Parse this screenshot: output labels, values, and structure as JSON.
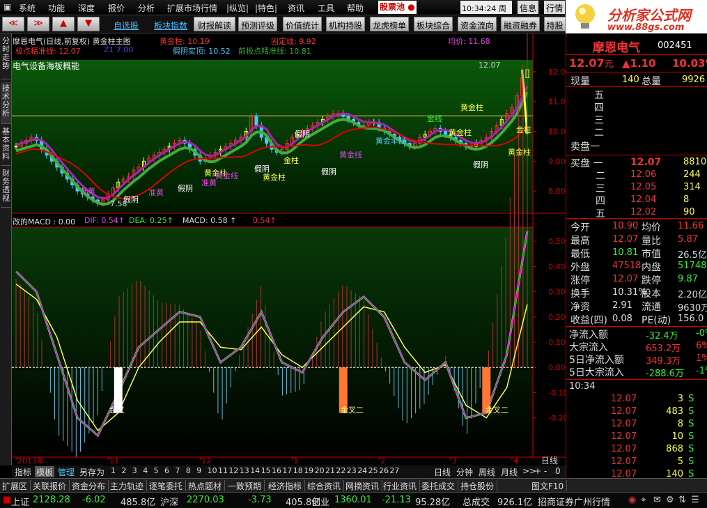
{
  "menu": {
    "items": [
      "系统",
      "功能",
      "深度",
      "报价",
      "分析",
      "扩展市场行情",
      "|纵览|",
      "|特色|",
      "资讯",
      "工具",
      "帮助"
    ],
    "stock_pool": "股票池",
    "clock": "10:34:24 周五",
    "info": "信息",
    "quote": "行情"
  },
  "toolbar": {
    "buttons": [
      "财报解读",
      "预测评级",
      "价值统计",
      "机构持股",
      "龙虎榜单",
      "板块综合",
      "资金流向",
      "融资融券",
      "持股"
    ],
    "links": [
      "自选股",
      "板块指数"
    ]
  },
  "logo": {
    "title": "分析家公式网",
    "url": "www.88gs.com"
  },
  "sidetabs": [
    "分时走势",
    "技术分析",
    "基本资料",
    "财务透视"
  ],
  "main_chart": {
    "header": {
      "title": "摩恩电气(日线,前复权)",
      "indicator": "黄金柱主图",
      "huangjinzhu": "黄金柱:",
      "huangjinzhu_val": "10.19",
      "guding": "固定线:",
      "guding_val": "9.92",
      "junjia": "均价:",
      "junjia_val": "11.68",
      "jidian": "极点精准线:",
      "jidian_val": "12.07",
      "z1": "Z1",
      "z1_val": "7.00",
      "jiayin": "假阴实顶:",
      "jiayin_val": "10.52",
      "qianji": "前极点精准线:",
      "qianji_val": "10.81"
    },
    "sector": "电气设备海板概能",
    "high_label": "12.07",
    "low_label": "7.58",
    "annotations": [
      "黄金柱",
      "黄金柱",
      "黄金柱",
      "黄金柱",
      "黄金柱",
      "假阴",
      "假阴",
      "假阴",
      "假阴",
      "假阴",
      "假阴",
      "准黄",
      "准黄",
      "准黄",
      "金线",
      "黄金线",
      "黄金线",
      "黄金伞线",
      "金柱",
      "金柱"
    ]
  },
  "macd": {
    "name": "改的MACD",
    "v0": "0.00",
    "dif": "DIF:",
    "dif_val": "0.54",
    "dea": "DEA:",
    "dea_val": "0.25",
    "macd": "MACD:",
    "macd_val": "0.58",
    "extra": "0.54",
    "labels": [
      "金叉",
      "金叉二",
      "金叉二"
    ]
  },
  "chart_data": [
    {
      "type": "candlestick",
      "name": "price",
      "yaxis": [
        "12.00",
        "11.00",
        "10.00",
        "9.00",
        "8.00"
      ],
      "ylim": [
        7.3,
        12.35
      ],
      "x": [
        0,
        0.01,
        0.02,
        0.03,
        0.04,
        0.05,
        0.06,
        0.07,
        0.08,
        0.09,
        0.1,
        0.11,
        0.12,
        0.13,
        0.14,
        0.15,
        0.16,
        0.17,
        0.18,
        0.19,
        0.2,
        0.21,
        0.22,
        0.23,
        0.24,
        0.25,
        0.26,
        0.27,
        0.28,
        0.29,
        0.3,
        0.31,
        0.32,
        0.33,
        0.34,
        0.35,
        0.36,
        0.37,
        0.38,
        0.39,
        0.4,
        0.41,
        0.42,
        0.43,
        0.44,
        0.45,
        0.46,
        0.47,
        0.48,
        0.49,
        0.5,
        0.51,
        0.52,
        0.53,
        0.54,
        0.55,
        0.56,
        0.57,
        0.58,
        0.59,
        0.6,
        0.61,
        0.62,
        0.63,
        0.64,
        0.65,
        0.66,
        0.67,
        0.68,
        0.69,
        0.7,
        0.71,
        0.72,
        0.73,
        0.74,
        0.75,
        0.76,
        0.77,
        0.78,
        0.79,
        0.8,
        0.81,
        0.82,
        0.83,
        0.84,
        0.85,
        0.86,
        0.87,
        0.88,
        0.89,
        0.9,
        0.91,
        0.92,
        0.93,
        0.94,
        0.95,
        0.96,
        0.97,
        0.98,
        0.99,
        1
      ],
      "close": [
        9.5,
        9.6,
        9.7,
        9.8,
        9.7,
        9.4,
        9.2,
        9.0,
        8.8,
        8.6,
        8.4,
        8.2,
        8.0,
        7.9,
        7.8,
        7.7,
        7.6,
        7.7,
        7.9,
        8.1,
        8.3,
        8.4,
        8.5,
        8.7,
        8.8,
        9.0,
        9.1,
        9.2,
        9.3,
        9.4,
        9.5,
        9.6,
        9.7,
        9.6,
        9.4,
        9.2,
        9.0,
        9.1,
        9.2,
        9.3,
        9.4,
        9.5,
        9.6,
        9.7,
        9.8,
        10.0,
        10.5,
        10.2,
        9.8,
        9.6,
        9.4,
        9.3,
        9.4,
        9.6,
        9.8,
        9.9,
        10.0,
        10.1,
        10.2,
        10.3,
        10.4,
        10.5,
        10.6,
        10.6,
        10.5,
        10.4,
        10.3,
        10.2,
        10.2,
        10.3,
        10.3,
        10.1,
        10.0,
        9.9,
        9.8,
        9.7,
        9.6,
        9.5,
        9.6,
        9.8,
        9.9,
        10.0,
        10.1,
        10.0,
        9.9,
        9.8,
        9.7,
        9.6,
        9.5,
        9.5,
        9.6,
        9.7,
        9.8,
        10.0,
        10.2,
        10.4,
        10.6,
        10.8,
        11.2,
        11.8,
        12.07
      ]
    },
    {
      "type": "line",
      "name": "MACD",
      "yaxis": [
        "0.50",
        "0.40",
        "0.30",
        "0.20",
        "0.10",
        "0.00",
        "-0.10",
        "-0.20"
      ],
      "ylim": [
        -0.35,
        0.55
      ],
      "x": [
        0,
        0.04,
        0.08,
        0.12,
        0.16,
        0.2,
        0.24,
        0.28,
        0.32,
        0.36,
        0.4,
        0.44,
        0.48,
        0.52,
        0.56,
        0.6,
        0.64,
        0.68,
        0.72,
        0.76,
        0.8,
        0.84,
        0.88,
        0.92,
        0.96,
        1
      ],
      "dif": [
        0.38,
        0.3,
        0.05,
        -0.2,
        -0.27,
        -0.1,
        0.08,
        0.15,
        0.22,
        0.2,
        0.02,
        0.08,
        0.22,
        0.02,
        -0.02,
        0.12,
        0.22,
        0.28,
        0.2,
        0.02,
        -0.05,
        0.02,
        -0.2,
        -0.18,
        0.05,
        0.54
      ],
      "dea": [
        0.33,
        0.27,
        0.12,
        -0.13,
        -0.25,
        -0.18,
        0.0,
        0.1,
        0.18,
        0.18,
        0.08,
        0.07,
        0.16,
        0.05,
        0.0,
        0.08,
        0.16,
        0.24,
        0.22,
        0.08,
        -0.02,
        0.01,
        -0.15,
        -0.2,
        -0.08,
        0.25
      ]
    }
  ],
  "axis": {
    "dates": [
      "2013年",
      "11",
      "12",
      "1",
      "2",
      "3",
      "4"
    ]
  },
  "bottom": {
    "tabs": [
      "指标",
      "模板",
      "管理",
      "另存为"
    ],
    "nums": [
      "1",
      "2",
      "3",
      "4",
      "5",
      "6",
      "7",
      "8",
      "9",
      "10",
      "11",
      "12",
      "13",
      "14",
      "15",
      "16",
      "17",
      "18",
      "19",
      "20",
      "21",
      "22",
      "23",
      "24",
      "25",
      "26",
      "27"
    ],
    "periods": [
      "日线",
      "分钟",
      "周线",
      "月线"
    ],
    "extra": [
      ">>",
      "+",
      "-",
      "0"
    ],
    "rlabel": "日线"
  },
  "funcbar": [
    "扩展区",
    "关联报价",
    "资金分布",
    "主力轨迹",
    "逐笔委托",
    "热点题材",
    "一致预期",
    "经济指标",
    "综合资讯",
    "网摘资讯",
    "行业资讯",
    "委托成交",
    "持仓股份",
    "图文F10"
  ],
  "right": {
    "name": "摩恩电气",
    "code": "002451",
    "price": "12.07",
    "yuan": "元",
    "change": "▲1.10",
    "pct": "10.03%",
    "xianliang_lbl": "现量",
    "xianliang": "140",
    "zongliang_lbl": "总量",
    "zongliang": "9926",
    "sell": [
      {
        "l": "五",
        "p": "",
        "v": ""
      },
      {
        "l": "四",
        "p": "",
        "v": ""
      },
      {
        "l": "三",
        "p": "",
        "v": ""
      },
      {
        "l": "二",
        "p": "",
        "v": ""
      },
      {
        "l": "卖盘一",
        "p": "",
        "v": ""
      }
    ],
    "buy": [
      {
        "l": "买盘 一",
        "p": "12.07",
        "v": "8810"
      },
      {
        "l": "二",
        "p": "12.06",
        "v": "244"
      },
      {
        "l": "三",
        "p": "12.05",
        "v": "314"
      },
      {
        "l": "四",
        "p": "12.04",
        "v": "8"
      },
      {
        "l": "五",
        "p": "12.02",
        "v": "90"
      }
    ],
    "stats": [
      {
        "l1": "今开",
        "v1": "10.90",
        "c1": "#e33",
        "l2": "均价",
        "v2": "11.66",
        "c2": "#e33"
      },
      {
        "l1": "最高",
        "v1": "12.07",
        "c1": "#e33",
        "l2": "量比",
        "v2": "5.87",
        "c2": "#e33"
      },
      {
        "l1": "最低",
        "v1": "10.81",
        "c1": "#3e3",
        "l2": "市值",
        "v2": "26.5亿",
        "c2": "#ddd"
      },
      {
        "l1": "外盘",
        "v1": "47518",
        "c1": "#e33",
        "l2": "内盘",
        "v2": "51748",
        "c2": "#3e3"
      },
      {
        "l1": "涨停",
        "v1": "12.07",
        "c1": "#e33",
        "l2": "跌停",
        "v2": "9.87",
        "c2": "#3e3"
      },
      {
        "l1": "换手",
        "v1": "10.31%",
        "c1": "#ddd",
        "l2": "股本",
        "v2": "2.20亿",
        "c2": "#ddd"
      },
      {
        "l1": "净资",
        "v1": "2.91",
        "c1": "#ddd",
        "l2": "流通",
        "v2": "9630万",
        "c2": "#ddd"
      },
      {
        "l1": "收益(四)",
        "v1": "0.08",
        "c1": "#ddd",
        "l2": "PE(动)",
        "v2": "156.0",
        "c2": "#ddd"
      }
    ],
    "flows": [
      {
        "l": "净流入额",
        "v": "-32.4万",
        "c": "#3e3",
        "v2": "-0%"
      },
      {
        "l": "大宗流入",
        "v": "653.2万",
        "c": "#e33",
        "v2": "6%"
      },
      {
        "l": "5日净流入额",
        "v": "349.3万",
        "c": "#e33",
        "v2": "1%"
      },
      {
        "l": "5日大宗流入",
        "v": "-288.6万",
        "c": "#3e3",
        "v2": "-1%"
      }
    ],
    "ticks_time": "10:34",
    "ticks": [
      {
        "p": "12.07",
        "v": "3",
        "s": "S"
      },
      {
        "p": "12.07",
        "v": "483",
        "s": "S"
      },
      {
        "p": "12.07",
        "v": "8",
        "s": "S"
      },
      {
        "p": "12.07",
        "v": "10",
        "s": "S"
      },
      {
        "p": "12.07",
        "v": "868",
        "s": "S"
      },
      {
        "p": "12.07",
        "v": "5",
        "s": "S"
      },
      {
        "p": "12.07",
        "v": "140",
        "s": "S"
      }
    ],
    "tabs": [
      "笔",
      "价",
      "细",
      "盘",
      "势",
      "指",
      "值",
      "主"
    ]
  },
  "status": {
    "sh_lbl": "上证",
    "sh": "2128.28",
    "sh_chg": "-6.02",
    "sh_amt": "485.8亿",
    "hs_lbl": "沪深",
    "hs": "2270.03",
    "hs_chg": "-3.73",
    "hs_amt": "405.8亿",
    "cy_lbl": "创业",
    "cy": "1360.01",
    "cy_chg": "-21.13",
    "cy_amt": "95.28亿",
    "total_lbl": "总成交",
    "total": "926.1亿",
    "broker": "招商证券广州行情"
  },
  "colors": {
    "up": "#e33",
    "down": "#3e3",
    "bg": "#000",
    "accent": "#c00"
  }
}
